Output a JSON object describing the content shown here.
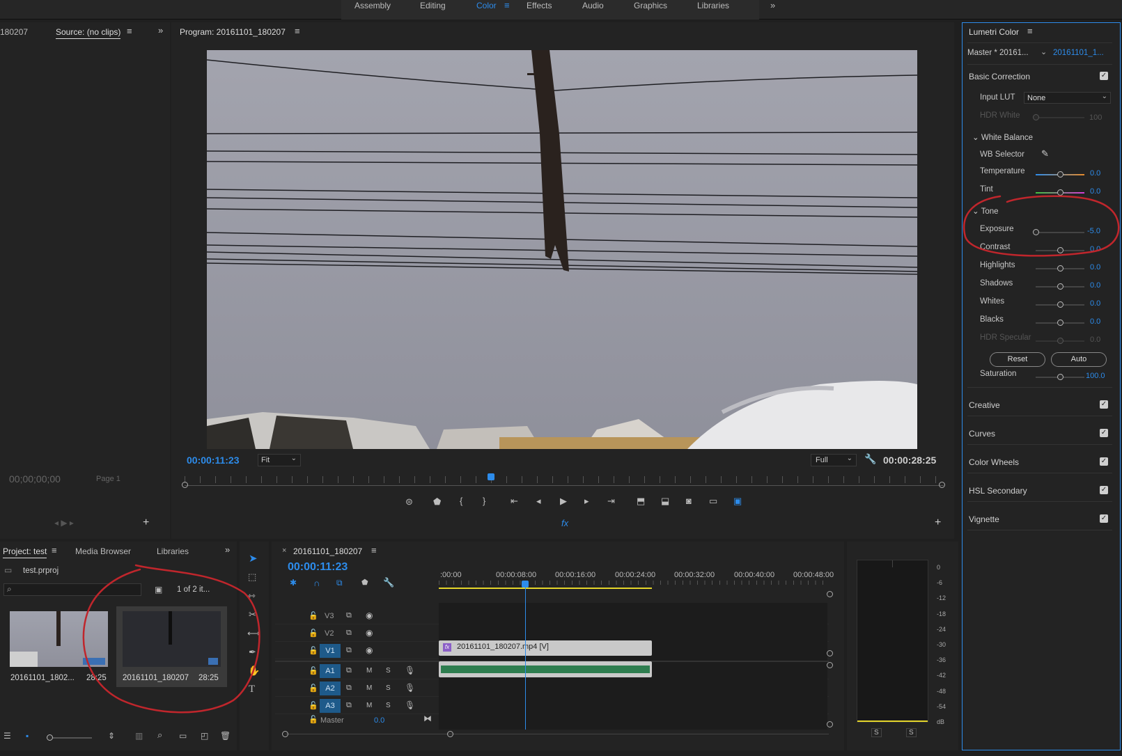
{
  "workspaces": {
    "tabs": [
      "Assembly",
      "Editing",
      "Color",
      "Effects",
      "Audio",
      "Graphics",
      "Libraries"
    ],
    "active": "Color"
  },
  "source": {
    "prev_tab": "180207",
    "tab": "Source: (no clips)",
    "timecode": "00;00;00;00",
    "page": "Page 1"
  },
  "program": {
    "title": "Program: 20161101_180207",
    "timecode": "00:00:11:23",
    "fit": "Fit",
    "quality": "Full",
    "duration": "00:00:28:25",
    "fx": "fx"
  },
  "project": {
    "tabs": [
      "Project: test",
      "Media Browser",
      "Libraries"
    ],
    "file": "test.prproj",
    "count": "1 of 2 it...",
    "items": [
      {
        "name": "20161101_1802...",
        "dur": "28:25"
      },
      {
        "name": "20161101_180207",
        "dur": "28:25"
      }
    ]
  },
  "timeline": {
    "title": "20161101_180207",
    "timecode": "00:00:11:23",
    "ruler": [
      ":00:00",
      "00:00:08:00",
      "00:00:16:00",
      "00:00:24:00",
      "00:00:32:00",
      "00:00:40:00",
      "00:00:48:00"
    ],
    "video_tracks": [
      "V3",
      "V2",
      "V1"
    ],
    "audio_tracks": [
      "A1",
      "A2",
      "A3"
    ],
    "master_label": "Master",
    "master_val": "0.0",
    "clip": "20161101_180207.mp4 [V]",
    "m": "M",
    "s": "S"
  },
  "meter": {
    "scale": [
      "0",
      "-6",
      "-12",
      "-18",
      "-24",
      "-30",
      "-36",
      "-42",
      "-48",
      "-54",
      "dB"
    ],
    "solo": [
      "S",
      "S"
    ]
  },
  "lumetri": {
    "title": "Lumetri Color",
    "master": "Master * 20161...",
    "clip": "20161101_1...",
    "basic": "Basic Correction",
    "input_lut_label": "Input LUT",
    "input_lut": "None",
    "hdr_white": "HDR White",
    "hdr_white_val": "100",
    "white_balance": "White Balance",
    "wb_selector": "WB Selector",
    "tone": "Tone",
    "reset": "Reset",
    "auto": "Auto",
    "params": [
      {
        "label": "Temperature",
        "value": "0.0",
        "level": 0.5
      },
      {
        "label": "Tint",
        "value": "0.0",
        "level": 0.5
      },
      {
        "label": "Exposure",
        "value": "-5.0",
        "level": 0.0
      },
      {
        "label": "Contrast",
        "value": "0.0",
        "level": 0.5
      },
      {
        "label": "Highlights",
        "value": "0.0",
        "level": 0.5
      },
      {
        "label": "Shadows",
        "value": "0.0",
        "level": 0.5
      },
      {
        "label": "Whites",
        "value": "0.0",
        "level": 0.5
      },
      {
        "label": "Blacks",
        "value": "0.0",
        "level": 0.5
      },
      {
        "label": "HDR Specular",
        "value": "0.0",
        "level": 0.5
      },
      {
        "label": "Saturation",
        "value": "100.0",
        "level": 0.5
      }
    ],
    "sections": [
      "Creative",
      "Curves",
      "Color Wheels",
      "HSL Secondary",
      "Vignette"
    ]
  },
  "colors": {
    "accent": "#2d8ceb",
    "annotation": "#c0262c",
    "clip_video": "#c9c9c9",
    "clip_audio": "#2e7d4f"
  }
}
